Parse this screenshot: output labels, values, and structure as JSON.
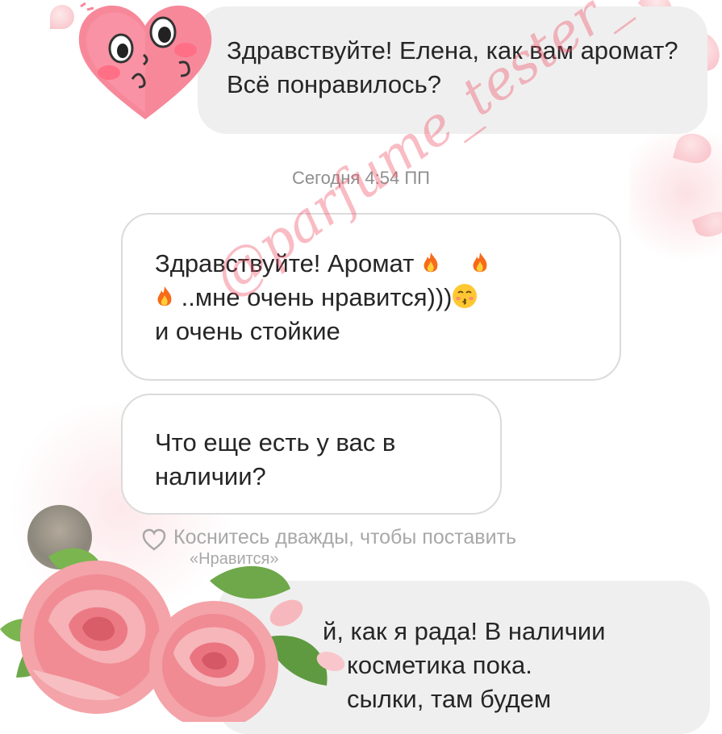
{
  "chat": {
    "messages": [
      {
        "sender": "shop",
        "text": "Здравствуйте! Елена, как вам аромат? Всё понравилось?"
      },
      {
        "sender": "customer",
        "line1": "Здравствуйте! Аромат",
        "line2": "..мне очень нравится)))",
        "line3": "и очень стойкие",
        "emoji": [
          "fire",
          "fire",
          "fire",
          "kissing-smiling-eyes"
        ]
      },
      {
        "sender": "customer",
        "text": "Что еще есть у вас в наличии?"
      },
      {
        "sender": "shop",
        "line1": "й, как я рада! В наличии",
        "line2": "косметика пока.",
        "line3": "сылки, там будем"
      }
    ],
    "timestamp": "Сегодня 4:54 ПП",
    "double_tap_hint_line1": "Коснитесь дважды, чтобы поставить",
    "double_tap_hint_line2": "«Нравится»"
  },
  "watermark": "@parfume_tester_",
  "colors": {
    "incoming_bubble": "#efefef",
    "outgoing_border": "#dbdbdb",
    "accent_pink": "#f06478"
  },
  "icons": [
    "heart-sticker-icon",
    "fire-emoji-icon",
    "kissing-face-emoji-icon",
    "heart-outline-icon",
    "rose-flowers-decoration"
  ]
}
